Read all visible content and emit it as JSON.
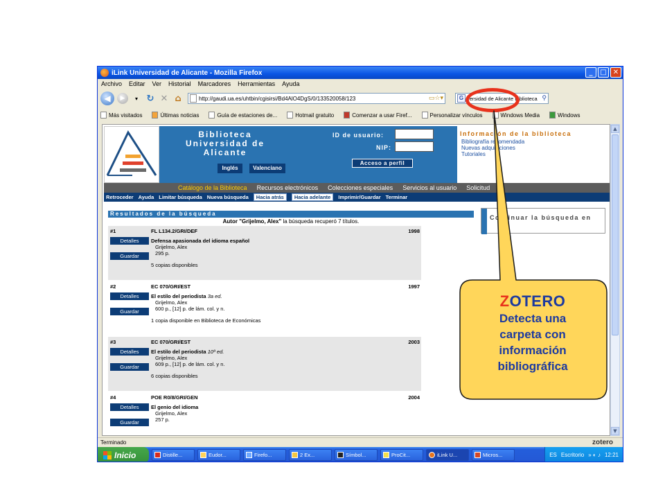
{
  "window": {
    "title": "iLink Universidad de Alicante - Mozilla Firefox",
    "buttons": {
      "minimize": "_",
      "maximize": "□",
      "close": "✕"
    }
  },
  "menu": [
    "Archivo",
    "Editar",
    "Ver",
    "Historial",
    "Marcadores",
    "Herramientas",
    "Ayuda"
  ],
  "nav": {
    "url": "http://gaudi.ua.es/uhtbin/cgisirsi/Bd4AlO4DgS/0/133520058/123",
    "search_value": "versidad de Alicante Biblioteca"
  },
  "bookmarks": [
    "Más visitados",
    "Últimas noticias",
    "Guía de estaciones de...",
    "Hotmail gratuito",
    "Comenzar a usar Firef...",
    "Personalizar vínculos",
    "Windows Media",
    "Windows"
  ],
  "library": {
    "title_line1": "Biblioteca",
    "title_line2": "Universidad de Alicante",
    "user_id_label": "ID de usuario:",
    "nip_label": "NIP:",
    "profile_button": "Acceso a perfil",
    "english_button": "Inglés",
    "valencian_button": "Valenciano",
    "info_title": "Información de la biblioteca",
    "info_links": [
      "Bibliografía recomendada",
      "Nuevas adquisiciones",
      "Tutoriales"
    ]
  },
  "category_tabs": [
    "Catálogo de la Biblioteca",
    "Recursos electrónicos",
    "Colecciones especiales",
    "Servicios al usuario",
    "Solicitud"
  ],
  "subnav": [
    "Retroceder",
    "Ayuda",
    "Limitar búsqueda",
    "Nueva búsqueda",
    "Hacia atrás",
    "Hacia adelante",
    "Imprimir/Guardar",
    "Terminar"
  ],
  "results": {
    "header": "Resultados de la búsqueda",
    "summary_query": "Autor \"Grijelmo, Alex\"",
    "summary_rest": " la búsqueda recuperó 7 títulos.",
    "details_label": "Detalles",
    "save_label": "Guardar",
    "records": [
      {
        "num": "#1",
        "call": "FL L134.2/GRI/DEF",
        "year": "1998",
        "title": "Defensa apasionada del idioma español",
        "edition": "",
        "author": "Grijelmo, Alex",
        "pages": "295 p.",
        "copies": "5 copias disponibles"
      },
      {
        "num": "#2",
        "call": "EC 070/GRI/EST",
        "year": "1997",
        "title": "El estilo del periodista",
        "edition": "3a ed.",
        "author": "Grijelmo, Alex",
        "pages": "600 p., [12] p. de lám. col. y n.",
        "copies": "1 copia disponible en Biblioteca de Económicas"
      },
      {
        "num": "#3",
        "call": "EC 070/GRI/EST",
        "year": "2003",
        "title": "El estilo del periodista",
        "edition": "10ª ed.",
        "author": "Grijelmo, Alex",
        "pages": "609 p., [12] p. de lám. col. y n.",
        "copies": "6 copias disponibles"
      },
      {
        "num": "#4",
        "call": "POE R0/8/GRI/GEN",
        "year": "2004",
        "title": "El genio del idioma",
        "edition": "",
        "author": "Grijelmo, Alex",
        "pages": "257 p.",
        "copies": ""
      }
    ],
    "refine_text": "Continuar la búsqueda en"
  },
  "status": {
    "text": "Terminado",
    "zotero": "zotero"
  },
  "taskbar": {
    "start": "Inicio",
    "tasks": [
      "Distille...",
      "Eudor...",
      "Firefo...",
      "2 Ex...",
      "Símbol...",
      "ProCit...",
      "iLink U...",
      "Micros..."
    ],
    "lang": "ES",
    "desktop": "Escritorio",
    "clock": "12:21"
  },
  "callout": {
    "title_first": "Z",
    "title_rest": "OTERO",
    "body_lines": [
      "Detecta una",
      "carpeta con",
      "información",
      "bibliográfica"
    ]
  },
  "colors": {
    "callout_fill": "#ffd65a",
    "callout_border": "#1a1a1a",
    "ring": "#e8321c",
    "header_blue": "#2a73b1",
    "nav_dark": "#0c3c76"
  }
}
